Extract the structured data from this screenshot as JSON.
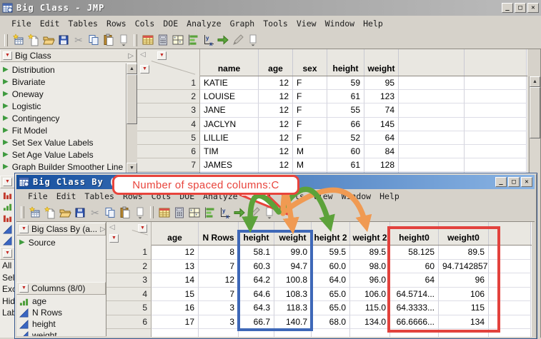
{
  "top_window": {
    "title": "Big Class - JMP",
    "menu": [
      "File",
      "Edit",
      "Tables",
      "Rows",
      "Cols",
      "DOE",
      "Analyze",
      "Graph",
      "Tools",
      "View",
      "Window",
      "Help"
    ],
    "toolbar_icons": [
      "new-table",
      "new-journal",
      "open",
      "save",
      "cut",
      "copy",
      "paste",
      "toolbar-overflow",
      "data-table",
      "calculator",
      "grid-pane",
      "bar-chart",
      "plot-yx",
      "join",
      "edit",
      "toolbar-overflow"
    ],
    "window_buttons": [
      "minimize",
      "maximize",
      "close"
    ],
    "sidebar": {
      "header": "Big Class",
      "scripts": [
        "Distribution",
        "Bivariate",
        "Oneway",
        "Logistic",
        "Contingency",
        "Fit Model",
        "Set Sex Value Labels",
        "Set Age Value Labels",
        "Graph Builder Smoother Line"
      ],
      "columns_strip_icons": [
        "nominal",
        "ordinal",
        "nominal",
        "continuous",
        "continuous"
      ],
      "rows_strip_labels": [
        "All",
        "Sel",
        "Exc",
        "Hid",
        "Lab"
      ]
    },
    "table": {
      "columns": [
        "name",
        "age",
        "sex",
        "height",
        "weight"
      ],
      "rows": [
        [
          "1",
          "KATIE",
          "12",
          "F",
          "59",
          "95"
        ],
        [
          "2",
          "LOUISE",
          "12",
          "F",
          "61",
          "123"
        ],
        [
          "3",
          "JANE",
          "12",
          "F",
          "55",
          "74"
        ],
        [
          "4",
          "JACLYN",
          "12",
          "F",
          "66",
          "145"
        ],
        [
          "5",
          "LILLIE",
          "12",
          "F",
          "52",
          "64"
        ],
        [
          "6",
          "TIM",
          "12",
          "M",
          "60",
          "84"
        ],
        [
          "7",
          "JAMES",
          "12",
          "M",
          "61",
          "128"
        ]
      ]
    }
  },
  "bottom_window": {
    "title": "Big Class By (",
    "menu": [
      "File",
      "Edit",
      "Tables",
      "Rows",
      "Cols",
      "DOE",
      "Analyze",
      "Graph",
      "Tools",
      "View",
      "Window",
      "Help"
    ],
    "toolbar_icons": [
      "new-table",
      "new-journal",
      "open",
      "save",
      "cut",
      "copy",
      "paste",
      "toolbar-overflow",
      "data-table",
      "calculator",
      "grid-pane",
      "bar-chart",
      "plot-yx",
      "join",
      "edit",
      "toolbar-overflow"
    ],
    "window_buttons": [
      "minimize",
      "maximize",
      "close"
    ],
    "sidebar": {
      "source_panel": {
        "header": "Big Class By (a...",
        "items": [
          "Source"
        ]
      },
      "columns_panel": {
        "header": "Columns (8/0)",
        "items": [
          {
            "label": "age",
            "icon": "ordinal"
          },
          {
            "label": "N Rows",
            "icon": "continuous"
          },
          {
            "label": "height",
            "icon": "continuous"
          },
          {
            "label": "weight",
            "icon": "continuous"
          }
        ]
      }
    },
    "table": {
      "columns": [
        "age",
        "N Rows",
        "height",
        "weight",
        "height 2",
        "weight 2",
        "height0",
        "weight0"
      ],
      "rows": [
        [
          "1",
          "12",
          "8",
          "58.1",
          "99.0",
          "59.5",
          "89.5",
          "58.125",
          "89.5"
        ],
        [
          "2",
          "13",
          "7",
          "60.3",
          "94.7",
          "60.0",
          "98.0",
          "60",
          "94.7142857"
        ],
        [
          "3",
          "14",
          "12",
          "64.2",
          "100.8",
          "64.0",
          "96.0",
          "64",
          "96"
        ],
        [
          "4",
          "15",
          "7",
          "64.6",
          "108.3",
          "65.0",
          "106.0",
          "64.5714...",
          "106"
        ],
        [
          "5",
          "16",
          "3",
          "64.3",
          "118.3",
          "65.0",
          "115.0",
          "64.3333...",
          "115"
        ],
        [
          "6",
          "17",
          "3",
          "66.7",
          "140.7",
          "68.0",
          "134.0",
          "66.6666...",
          "134"
        ]
      ]
    }
  },
  "annotation": {
    "callout_text": "Number of spaced columns:C",
    "colors": {
      "callout_red": "#e8443c",
      "blue_box": "#3e68b8",
      "red_box": "#e2423d",
      "green_arrow": "#5ca23a",
      "orange_arrow": "#f09a52"
    }
  }
}
